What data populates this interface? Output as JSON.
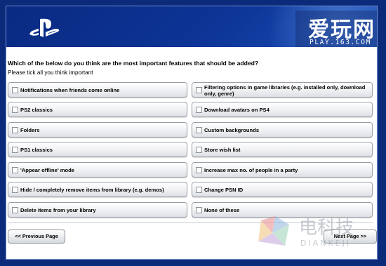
{
  "watermark_top": {
    "cn": "爱玩网",
    "url": "PLAY.163.COM"
  },
  "survey": {
    "question": "Which of the below do you think are the most important features that should be added?",
    "instruction": "Please tick all you think important",
    "left_options": [
      "Notifications when friends come online",
      "PS2 classics",
      "Folders",
      "PS1 classics",
      "'Appear offline' mode",
      "Hide / completely remove items from library (e.g. demos)",
      "Delete items from your library"
    ],
    "right_options": [
      "Filtering options in game libraries (e.g. installed only, download only, genre)",
      "Download avatars on PS4",
      "Custom backgrounds",
      "Store wish list",
      "Increase max no. of people in a party",
      "Change PSN ID",
      "None of these"
    ]
  },
  "nav": {
    "prev_label": "<< Previous Page",
    "next_label": "Next Page >>"
  },
  "watermark_bottom": {
    "cn": "电科技",
    "en": "DIANKEJI"
  },
  "colors": {
    "header_blue": "#0d3496",
    "page_background": "#0b2a7a"
  }
}
